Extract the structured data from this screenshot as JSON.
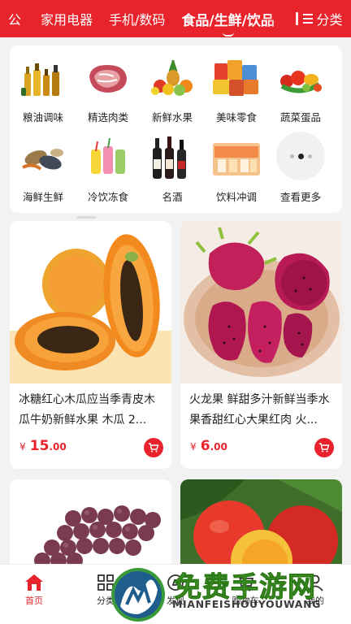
{
  "topbar": {
    "tabs": [
      {
        "label": "公",
        "active": false
      },
      {
        "label": "家用电器",
        "active": false
      },
      {
        "label": "手机/数码",
        "active": false
      },
      {
        "label": "食品/生鲜/饮品",
        "active": true
      }
    ],
    "category_button": "分类"
  },
  "categories": [
    {
      "label": "粮油调味",
      "icon": "oil-bottles-icon"
    },
    {
      "label": "精选肉类",
      "icon": "meat-icon"
    },
    {
      "label": "新鲜水果",
      "icon": "fruits-icon"
    },
    {
      "label": "美味零食",
      "icon": "snacks-icon"
    },
    {
      "label": "蔬菜蛋品",
      "icon": "vegetables-icon"
    },
    {
      "label": "海鲜生鲜",
      "icon": "seafood-icon"
    },
    {
      "label": "冷饮冻食",
      "icon": "cold-drinks-icon"
    },
    {
      "label": "名酒",
      "icon": "wine-icon"
    },
    {
      "label": "饮料冲调",
      "icon": "beverage-icon"
    },
    {
      "label": "查看更多",
      "icon": "more-dots-icon"
    }
  ],
  "products": [
    {
      "name": "冰糖红心木瓜应当季青皮木瓜牛奶新鲜水果 木瓜 2...",
      "currency": "¥",
      "price_int": "15",
      "price_dec": ".00"
    },
    {
      "name": "火龙果 鲜甜多汁新鲜当季水果香甜红心大果红肉 火...",
      "currency": "¥",
      "price_int": "6",
      "price_dec": ".00"
    },
    {
      "name": "",
      "currency": "",
      "price_int": "",
      "price_dec": ""
    },
    {
      "name": "",
      "currency": "",
      "price_int": "",
      "price_dec": ""
    }
  ],
  "bottomnav": [
    {
      "label": "首页",
      "active": true
    },
    {
      "label": "分类",
      "active": false
    },
    {
      "label": "发现",
      "active": false
    },
    {
      "label": "购物车",
      "active": false
    },
    {
      "label": "我的",
      "active": false
    }
  ],
  "watermark": {
    "title": "免费手游网",
    "subtitle": "MIANFEISHOUYOUWANG"
  },
  "colors": {
    "brand": "#e8232c",
    "watermark_green": "#5ab036"
  }
}
